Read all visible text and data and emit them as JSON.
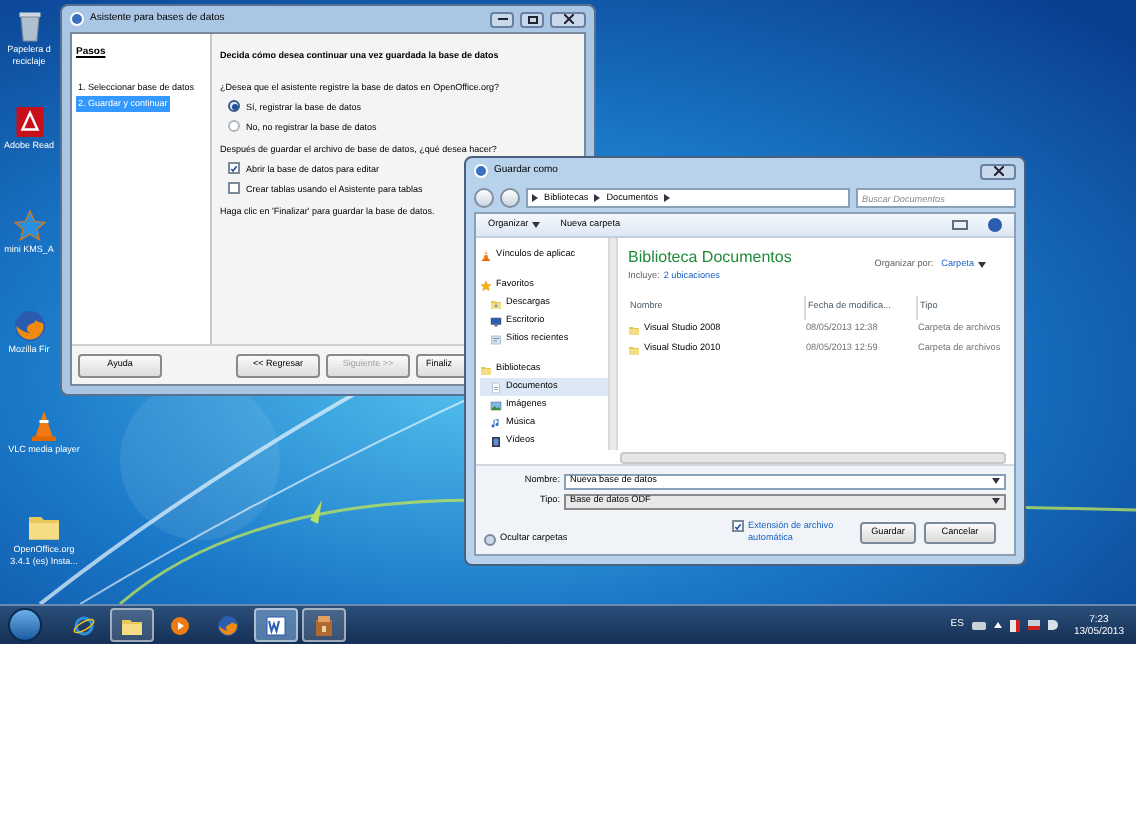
{
  "desktop_icons": [
    {
      "kind": "recycle",
      "lines": [
        "Papelera d",
        "reciclaje"
      ]
    },
    {
      "kind": "pdf",
      "lines": [
        "Adobe Read"
      ]
    },
    {
      "kind": "kms",
      "lines": [
        "mini KMS_A"
      ]
    },
    {
      "kind": "firefox",
      "lines": [
        "Mozilla Fir"
      ]
    },
    {
      "kind": "vlc",
      "lines": [
        "VLC media player"
      ]
    },
    {
      "kind": "folder",
      "lines": [
        "OpenOffice.org",
        "3.4.1 (es) Insta..."
      ]
    }
  ],
  "wizard": {
    "title": "Asistente para bases de datos",
    "steps_heading": "Pasos",
    "steps": [
      {
        "label": "1. Seleccionar base de datos",
        "selected": false
      },
      {
        "label": "2. Guardar y continuar",
        "selected": true
      }
    ],
    "heading": "Decida cómo desea continuar una vez guardada la base de datos",
    "question_1": "¿Desea que el asistente registre la base de datos en OpenOffice.org?",
    "radios": [
      {
        "label": "Sí, registrar la base de datos",
        "selected": true
      },
      {
        "label": "No, no registrar la base de datos",
        "selected": false
      }
    ],
    "question_2": "Después de guardar el archivo de base de datos, ¿qué desea hacer?",
    "checkboxes": [
      {
        "label": "Abrir la base de datos para editar",
        "checked": true
      },
      {
        "label": "Crear tablas usando el Asistente para tablas",
        "checked": false
      }
    ],
    "hint": "Haga clic en 'Finalizar' para guardar la base de datos.",
    "buttons": [
      {
        "label": "Ayuda",
        "disabled": false
      },
      {
        "label": "<< Regresar",
        "disabled": false
      },
      {
        "label": "Siguiente >>",
        "disabled": true
      },
      {
        "label": "Finaliz",
        "disabled": false
      }
    ]
  },
  "save_dialog": {
    "title": "Guardar como",
    "breadcrumb": [
      "Bibliotecas",
      "Documentos"
    ],
    "search": {
      "placeholder": "Buscar Documentos"
    },
    "organize": "Organizar",
    "new_folder": "Nueva carpeta",
    "nav": [
      {
        "kind": "cone",
        "label": "Vínculos de aplicac",
        "selected": false
      },
      {
        "kind": "star",
        "label": "Favoritos",
        "selected": false
      },
      {
        "kind": "downloads",
        "label": "Descargas",
        "selected": false
      },
      {
        "kind": "desktop",
        "label": "Escritorio",
        "selected": false
      },
      {
        "kind": "recent",
        "label": "Sitios recientes",
        "selected": false
      },
      {
        "kind": "library",
        "label": "Bibliotecas",
        "selected": false
      },
      {
        "kind": "documents",
        "label": "Documentos",
        "selected": true
      },
      {
        "kind": "pictures",
        "label": "Imágenes",
        "selected": false
      },
      {
        "kind": "music",
        "label": "Música",
        "selected": false
      },
      {
        "kind": "videos",
        "label": "Vídeos",
        "selected": false
      }
    ],
    "library_title": "Biblioteca Documentos",
    "includes_label": "Incluye:",
    "includes_link": "2 ubicaciones",
    "arrange_label": "Organizar por:",
    "arrange_value": "Carpeta",
    "columns": [
      "Nombre",
      "Fecha de modifica...",
      "Tipo"
    ],
    "rows": [
      {
        "name": "Visual Studio 2008",
        "date": "08/05/2013 12:38",
        "type": "Carpeta de archivos"
      },
      {
        "name": "Visual Studio 2010",
        "date": "08/05/2013 12:59",
        "type": "Carpeta de archivos"
      }
    ],
    "filename": {
      "label": "Nombre:",
      "value": "Nueva base de datos"
    },
    "filetype": {
      "label": "Tipo:",
      "value": "Base de datos ODF"
    },
    "extension": {
      "label": "Extensión de archivo automática",
      "checked": true
    },
    "save_button": "Guardar",
    "cancel_button": "Cancelar",
    "hide_folders": "Ocultar carpetas"
  },
  "taskbar": {
    "apps": [
      {
        "kind": "ie",
        "running": false,
        "selected": false
      },
      {
        "kind": "explorer",
        "running": true,
        "selected": false
      },
      {
        "kind": "mediaplayer",
        "running": false,
        "selected": false
      },
      {
        "kind": "firefox",
        "running": false,
        "selected": false
      },
      {
        "kind": "word",
        "running": true,
        "selected": true
      },
      {
        "kind": "installer",
        "running": true,
        "selected": false
      }
    ],
    "language": "ES",
    "time": "7:23",
    "date": "13/05/2013"
  }
}
